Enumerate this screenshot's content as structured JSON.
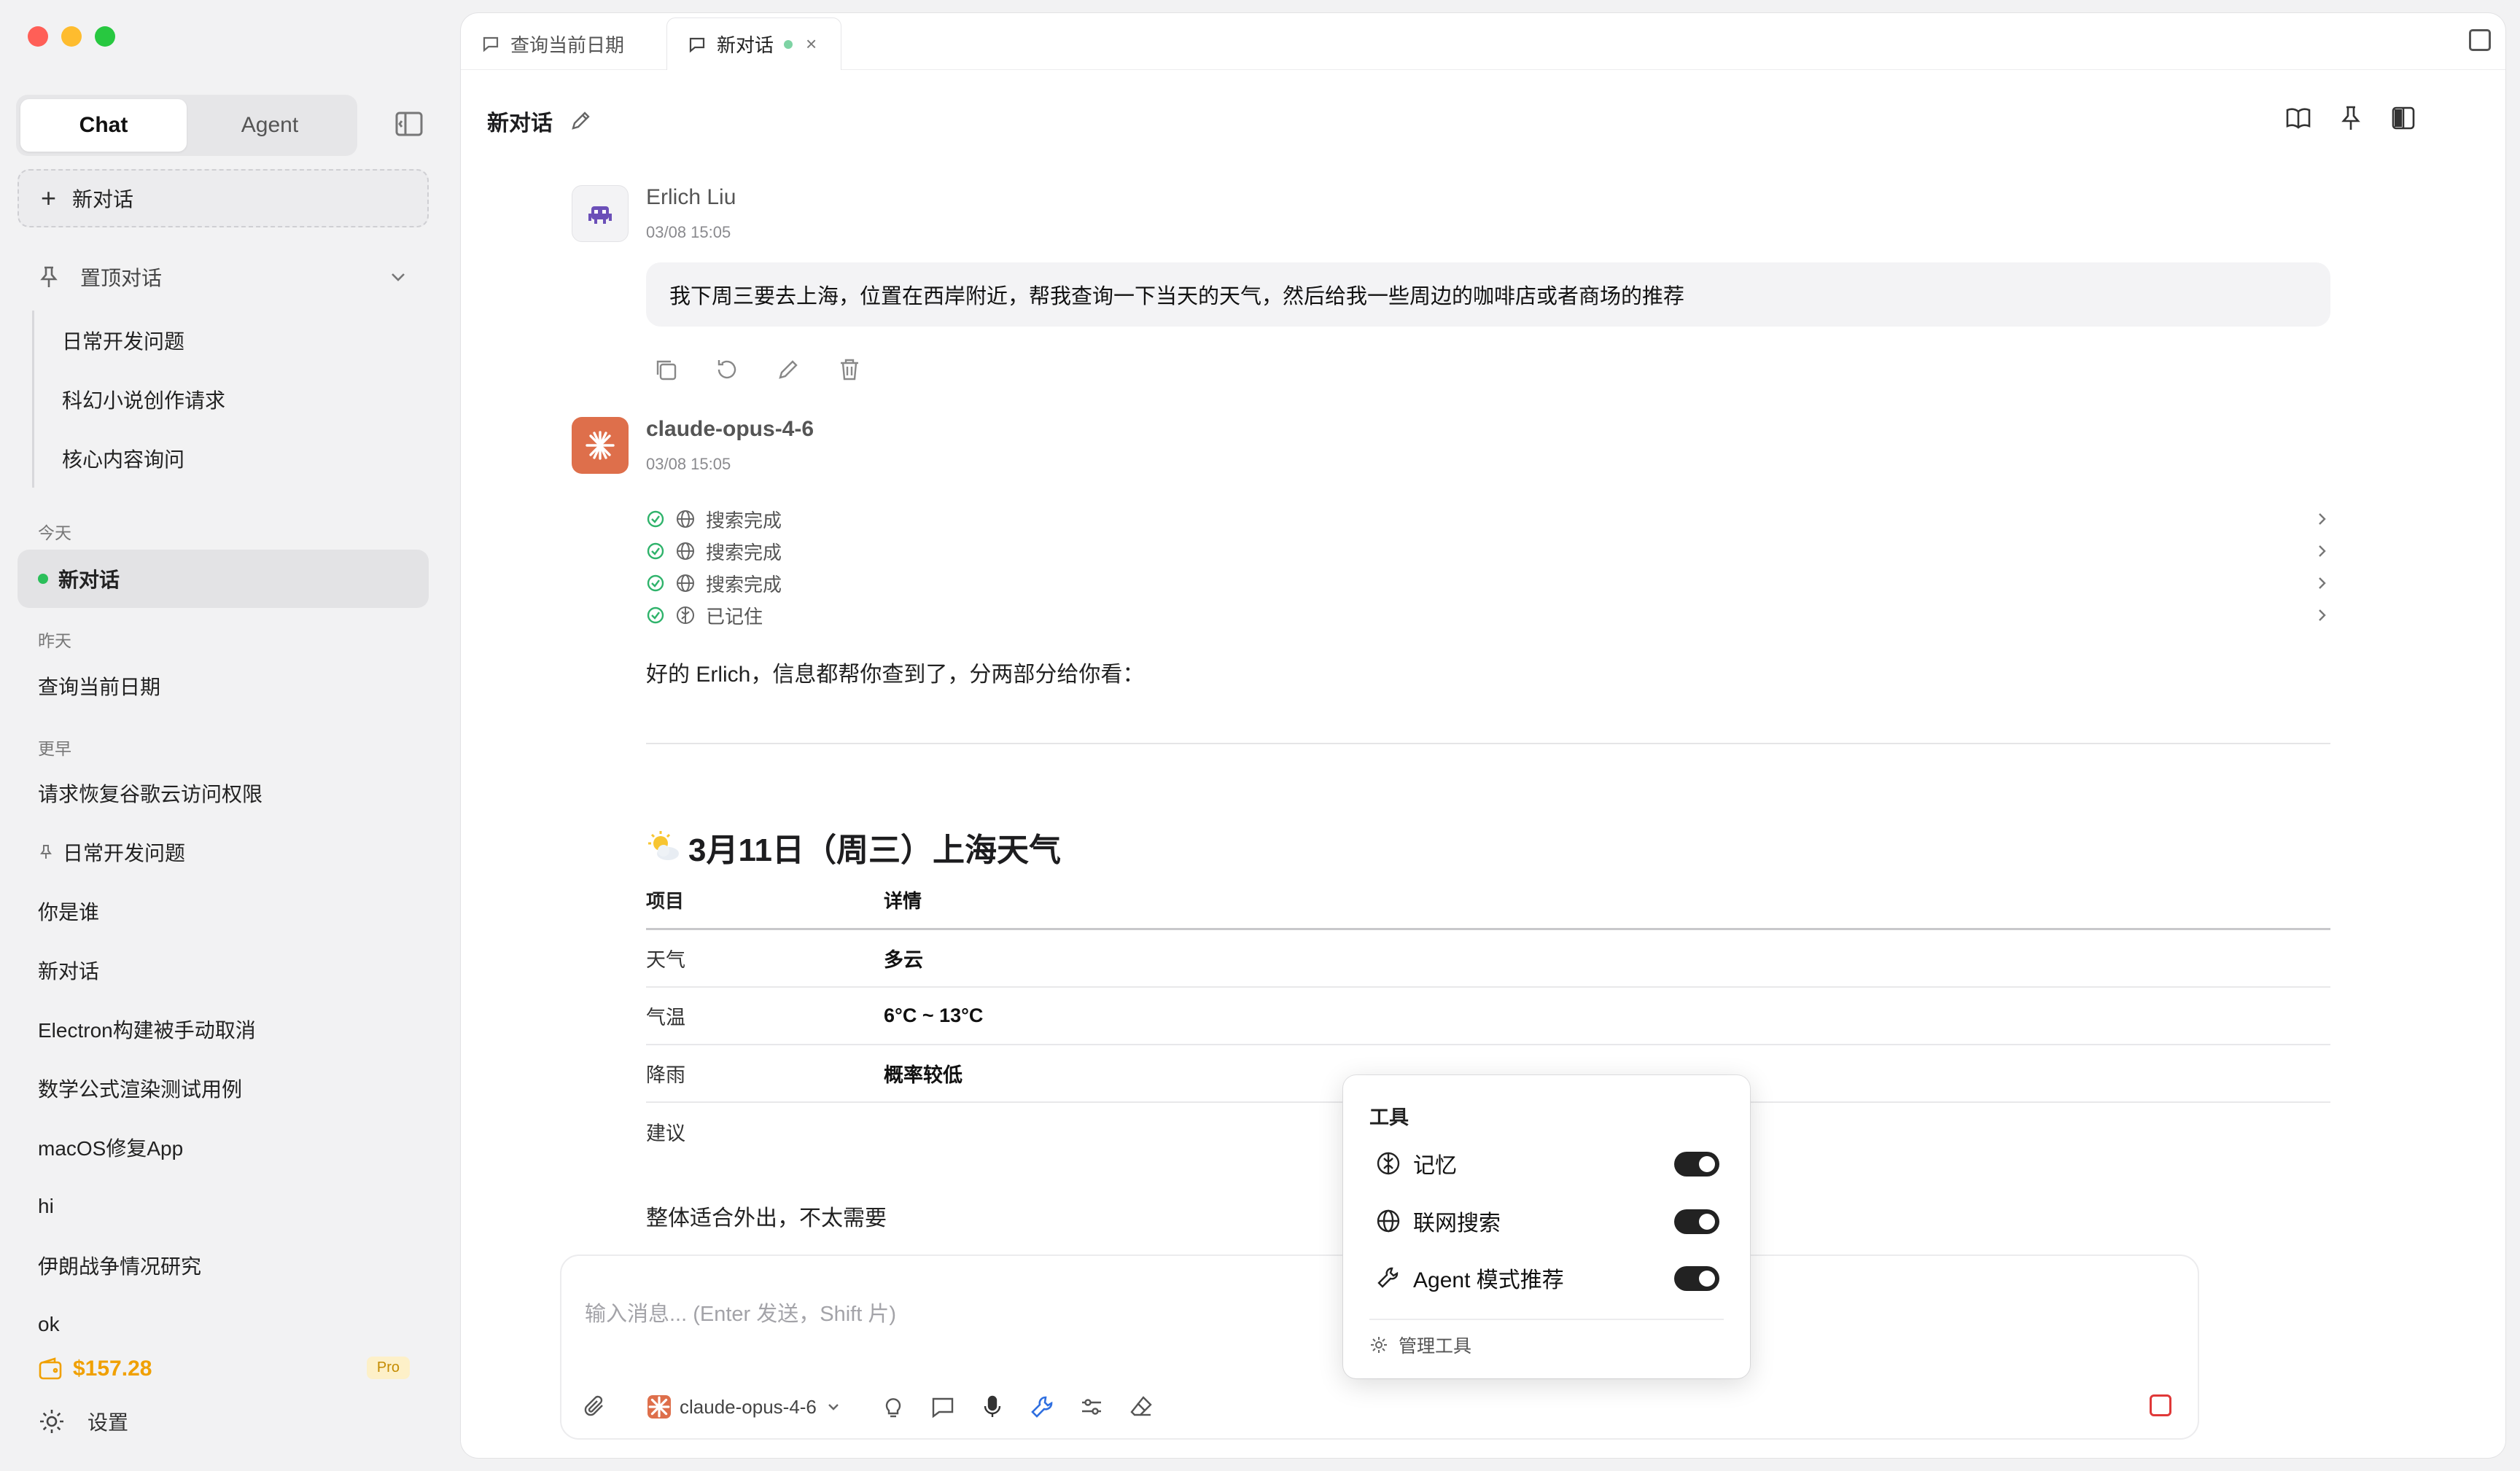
{
  "sidebar": {
    "mode_tabs": [
      "Chat",
      "Agent"
    ],
    "new_chat": "新对话",
    "pinned_header": "置顶对话",
    "pinned_items": [
      "日常开发问题",
      "科幻小说创作请求",
      "核心内容询问"
    ],
    "today_label": "今天",
    "today_items": [
      "新对话"
    ],
    "yesterday_label": "昨天",
    "yesterday_items": [
      "查询当前日期"
    ],
    "earlier_label": "更早",
    "earlier_items": [
      "请求恢复谷歌云访问权限",
      "日常开发问题",
      "你是谁",
      "新对话",
      "Electron构建被手动取消",
      "数学公式渲染测试用例",
      "macOS修复App",
      "hi",
      "伊朗战争情况研究",
      "ok"
    ],
    "balance": "$157.28",
    "plan_badge": "Pro",
    "settings": "设置"
  },
  "tabs": [
    {
      "label": "查询当前日期"
    },
    {
      "label": "新对话",
      "close": "×"
    }
  ],
  "conversation": {
    "title": "新对话",
    "user_msg": {
      "name": "Erlich Liu",
      "time": "03/08 15:05",
      "text": "我下周三要去上海，位置在西岸附近，帮我查询一下当天的天气，然后给我一些周边的咖啡店或者商场的推荐"
    },
    "bot_msg": {
      "name": "claude-opus-4-6",
      "time": "03/08 15:05",
      "steps": [
        "搜索完成",
        "搜索完成",
        "搜索完成",
        "已记住"
      ],
      "intro": "好的 Erlich，信息都帮你查到了，分两部分给你看：",
      "weather_heading": "3月11日（周三）上海天气",
      "table": {
        "headers": [
          "项目",
          "详情"
        ],
        "rows": [
          [
            "天气",
            "多云"
          ],
          [
            "气温",
            "6°C ~ 13°C"
          ],
          [
            "降雨",
            "概率较低"
          ],
          [
            "建议",
            ""
          ]
        ]
      },
      "after_text": "整体适合外出，不太需要"
    }
  },
  "composer": {
    "placeholder": "输入消息... (Enter 发送，Shift                                              片)",
    "model": "claude-opus-4-6"
  },
  "tools_popup": {
    "title": "工具",
    "items": [
      "记忆",
      "联网搜索",
      "Agent 模式推荐"
    ],
    "manage": "管理工具"
  }
}
